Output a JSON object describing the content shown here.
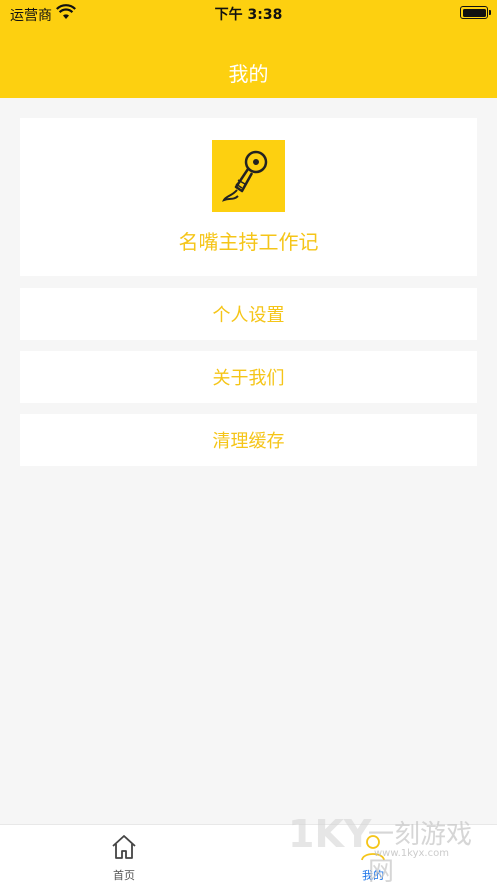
{
  "status_bar": {
    "carrier": "运营商",
    "time": "下午 3:38"
  },
  "nav": {
    "title": "我的"
  },
  "profile": {
    "app_name": "名嘴主持工作记"
  },
  "menu": [
    {
      "label": "个人设置"
    },
    {
      "label": "关于我们"
    },
    {
      "label": "清理缓存"
    }
  ],
  "tabs": [
    {
      "label": "首页",
      "icon": "home-icon",
      "active": false
    },
    {
      "label": "我的",
      "icon": "person-icon",
      "active": true
    }
  ],
  "watermark": {
    "brand": "1KY",
    "cn": "一刻游戏网",
    "url": "www.1kyx.com"
  },
  "colors": {
    "brand": "#fdd010",
    "text_accent": "#f5c518",
    "tab_active": "#1a73e8",
    "background": "#f6f6f6"
  }
}
